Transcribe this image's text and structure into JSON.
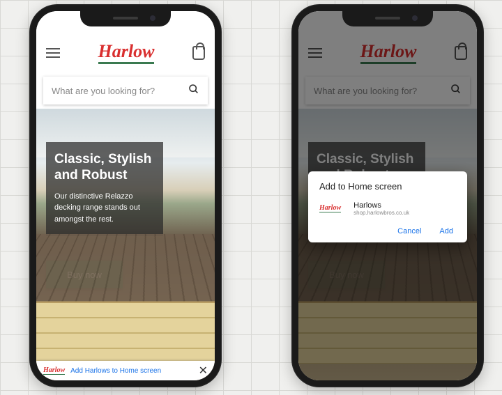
{
  "brand": "Harlow",
  "search": {
    "placeholder": "What are you looking for?"
  },
  "hero": {
    "title": "Classic, Stylish and Robust",
    "body": "Our distinctive Relazzo decking range stands out amongst the rest.",
    "cta": "Buy now"
  },
  "banner": {
    "text": "Add Harlows to Home screen"
  },
  "dialog": {
    "title": "Add to Home screen",
    "app_name": "Harlows",
    "app_url": "shop.harlowbros.co.uk",
    "cancel": "Cancel",
    "add": "Add"
  }
}
